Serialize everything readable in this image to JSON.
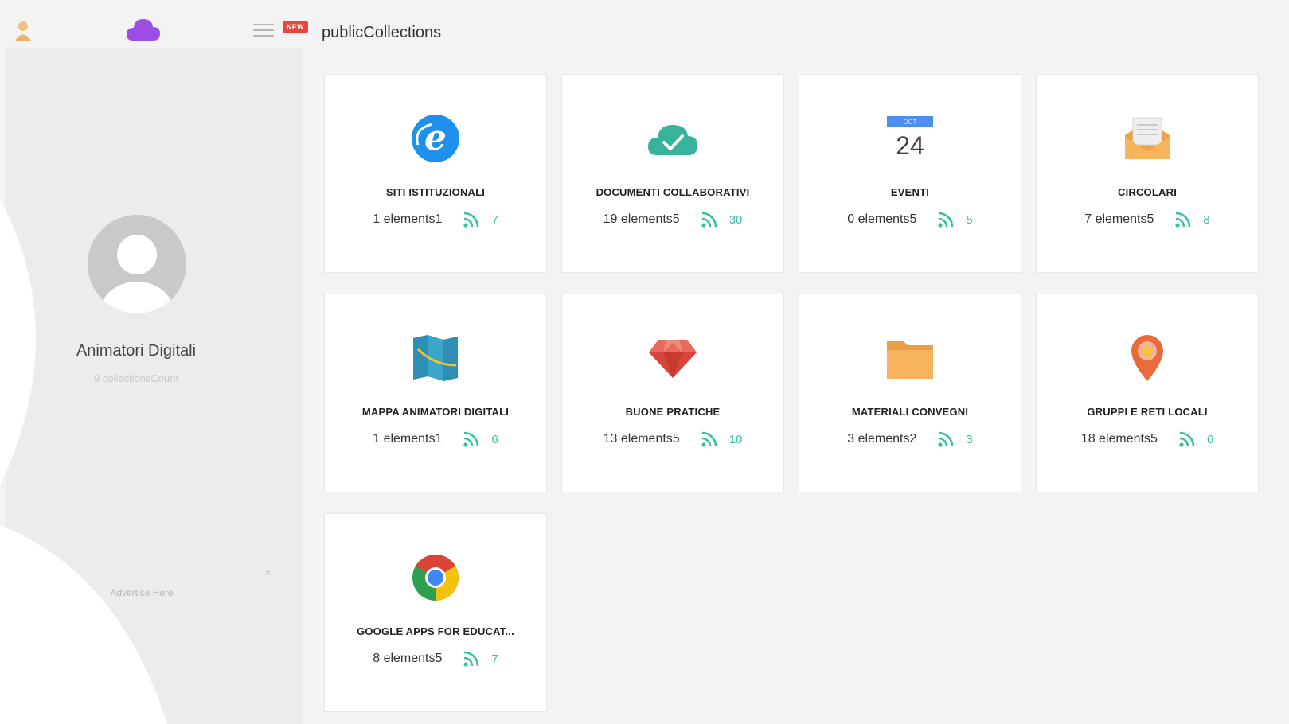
{
  "header": {
    "new_badge": "NEW",
    "title": "publicCollections"
  },
  "profile": {
    "name": "Animatori Digitali",
    "collections_count": "9 collectionsCount"
  },
  "ad": {
    "text": "Advertise Here",
    "close": "×"
  },
  "colors": {
    "accent_green": "#36c1a0",
    "logo_purple": "#9b4de6",
    "badge_red": "#e8453c"
  },
  "calendar": {
    "month": "OCT",
    "day": "24"
  },
  "collections": [
    {
      "title": "SITI ISTITUZIONALI",
      "elements": "1 elements1",
      "feeds": "7",
      "icon": "internet-explorer-icon"
    },
    {
      "title": "DOCUMENTI COLLABORATIVI",
      "elements": "19 elements5",
      "feeds": "30",
      "icon": "cloud-check-icon"
    },
    {
      "title": "EVENTI",
      "elements": "0 elements5",
      "feeds": "5",
      "icon": "calendar-icon"
    },
    {
      "title": "CIRCOLARI",
      "elements": "7 elements5",
      "feeds": "8",
      "icon": "open-envelope-icon"
    },
    {
      "title": "MAPPA ANIMATORI DIGITALI",
      "elements": "1 elements1",
      "feeds": "6",
      "icon": "map-icon"
    },
    {
      "title": "BUONE PRATICHE",
      "elements": "13 elements5",
      "feeds": "10",
      "icon": "ruby-gem-icon"
    },
    {
      "title": "MATERIALI CONVEGNI",
      "elements": "3 elements2",
      "feeds": "3",
      "icon": "folder-icon"
    },
    {
      "title": "GRUPPI E RETI LOCALI",
      "elements": "18 elements5",
      "feeds": "6",
      "icon": "map-pin-star-icon"
    },
    {
      "title": "GOOGLE APPS FOR EDUCAT...",
      "elements": "8 elements5",
      "feeds": "7",
      "icon": "chrome-icon"
    }
  ]
}
